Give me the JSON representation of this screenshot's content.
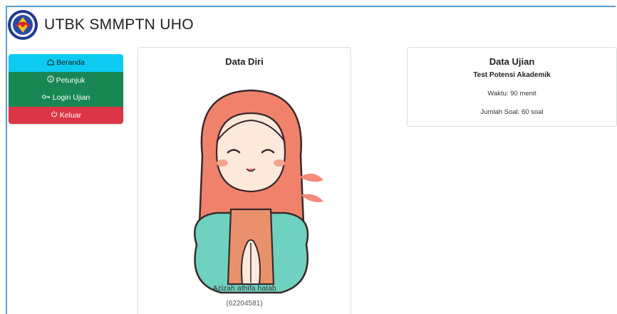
{
  "header": {
    "title": "UTBK SMMPTN UHO",
    "logo_icon": "university-seal-icon"
  },
  "menu": {
    "items": [
      {
        "label": "Beranda",
        "icon": "home-icon",
        "color": "#0dcaf0"
      },
      {
        "label": "Petunjuk",
        "icon": "info-icon",
        "color": "#198754"
      },
      {
        "label": "Login Ujian",
        "icon": "key-icon",
        "color": "#198754"
      },
      {
        "label": "Keluar",
        "icon": "power-icon",
        "color": "#dc3545"
      }
    ]
  },
  "profile": {
    "title": "Data Diri",
    "name": "Azizah athifa hatab",
    "id": "(62204581)"
  },
  "exam": {
    "title": "Data Ujian",
    "test_name": "Test Potensi Akademik",
    "duration": "Waktu: 90 menit",
    "question_count": "Jumlah Soal: 60 soal"
  }
}
